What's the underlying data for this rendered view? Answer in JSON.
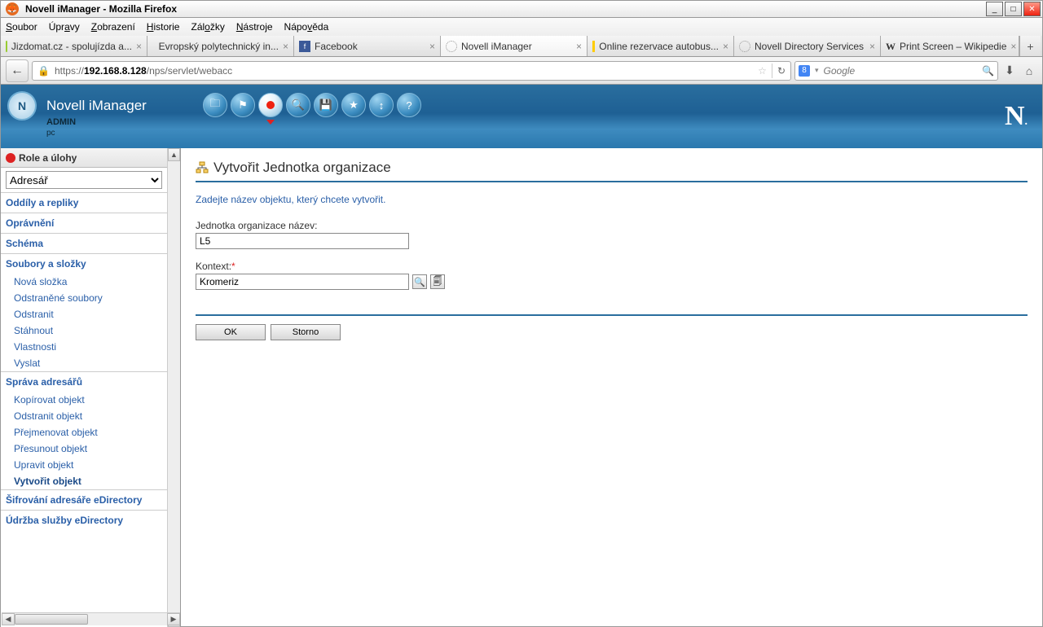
{
  "window": {
    "title": "Novell iManager - Mozilla Firefox"
  },
  "menu": {
    "soubor": "Soubor",
    "upravy": "Úpravy",
    "zobrazeni": "Zobrazení",
    "historie": "Historie",
    "zalozky": "Záložky",
    "nastroje": "Nástroje",
    "napoveda": "Nápověda"
  },
  "tabs": [
    {
      "label": "Jizdomat.cz - spolujízda a..."
    },
    {
      "label": "Evropský polytechnický in..."
    },
    {
      "label": "Facebook"
    },
    {
      "label": "Novell iManager"
    },
    {
      "label": "Online rezervace autobus..."
    },
    {
      "label": "Novell Directory Services"
    },
    {
      "label": "Print Screen – Wikipedie"
    }
  ],
  "url": {
    "host": "192.168.8.128",
    "path": "/nps/servlet/webacc"
  },
  "search": {
    "placeholder": "Google"
  },
  "app": {
    "title": "Novell iManager",
    "user": "ADMIN",
    "tree": "pc"
  },
  "sidebar": {
    "header": "Role a úlohy",
    "select": "Adresář",
    "cats": {
      "oddily": "Oddíly a repliky",
      "opravneni": "Oprávnění",
      "schema": "Schéma",
      "soubory": "Soubory a složky",
      "sprava": "Správa adresářů",
      "sifrovani": "Šifrování adresáře eDirectory",
      "udrzba": "Údržba služby eDirectory"
    },
    "soubory_items": [
      "Nová složka",
      "Odstraněné soubory",
      "Odstranit",
      "Stáhnout",
      "Vlastnosti",
      "Vyslat"
    ],
    "sprava_items": [
      "Kopírovat objekt",
      "Odstranit objekt",
      "Přejmenovat objekt",
      "Přesunout objekt",
      "Upravit objekt",
      "Vytvořit objekt"
    ]
  },
  "main": {
    "title": "Vytvořit Jednotka organizace",
    "hint": "Zadejte název objektu, který chcete vytvořit.",
    "name_label": "Jednotka organizace název:",
    "name_value": "L5",
    "ctx_label": "Kontext:",
    "ctx_value": "Kromeriz",
    "ok": "OK",
    "cancel": "Storno"
  }
}
